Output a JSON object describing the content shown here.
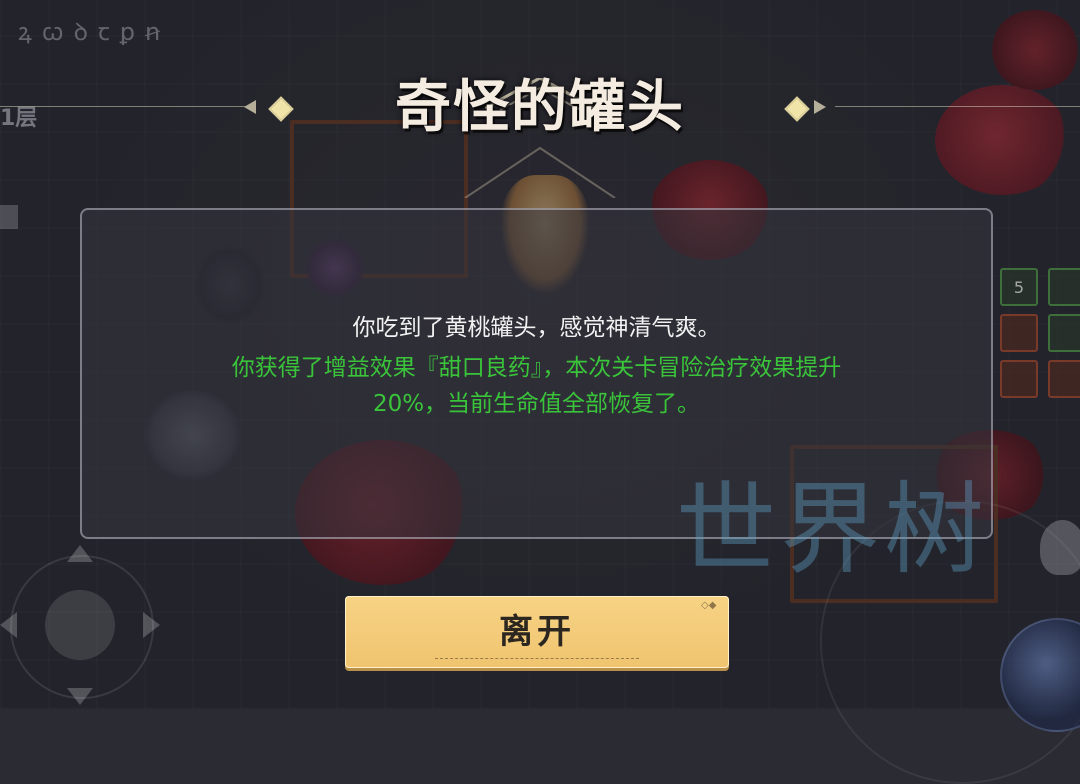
{
  "hud": {
    "top_icons": [
      "ꝝ",
      "ꞷ",
      "ꝺ",
      "ꞇ",
      "ꝑ",
      "ꞥ"
    ],
    "floor_label": "1层",
    "slots": [
      "5",
      "",
      "",
      "",
      "",
      ""
    ]
  },
  "dialog": {
    "title": "奇怪的罐头",
    "message_line": "你吃到了黄桃罐头，感觉神清气爽。",
    "buff_line_1": "你获得了增益效果『甜口良药』，本次关卡冒险治疗效果提升",
    "buff_line_2": "20%，当前生命值全部恢复了。",
    "leave_button": "离开",
    "colors": {
      "message": "#f2f2f2",
      "buff": "#39c43a",
      "button": "#f4cd7b"
    }
  },
  "watermark": "世界树",
  "icons": {
    "dpad": "dpad-icon",
    "skill": "skill-flame-icon",
    "title_ornament": "diamond-ornament-icon"
  }
}
